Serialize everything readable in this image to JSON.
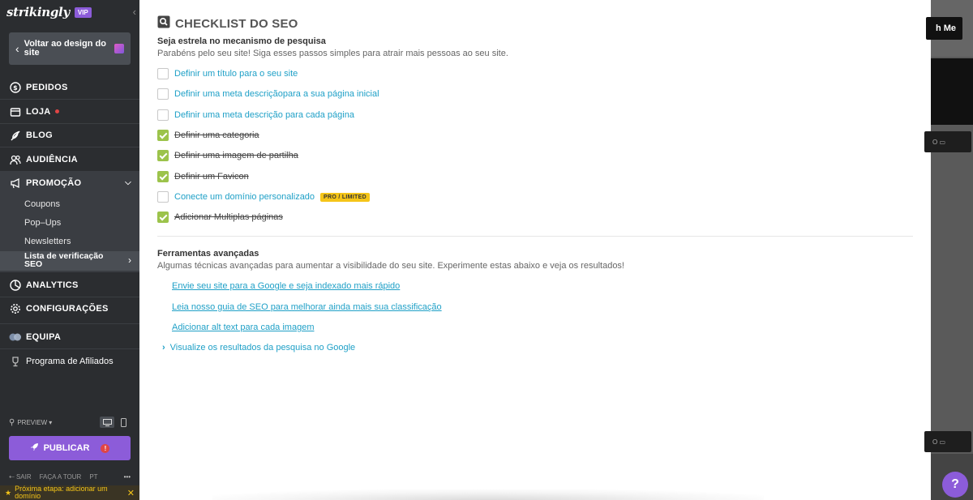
{
  "sidebar": {
    "logo": "strikingly",
    "vip": "VIP",
    "back_label": "Voltar ao design do site",
    "nav": {
      "pedidos": "PEDIDOS",
      "loja": "LOJA",
      "blog": "BLOG",
      "audiencia": "AUDIÊNCIA",
      "promocao": "PROMOÇÃO",
      "analytics": "ANALYTICS",
      "configuracoes": "CONFIGURAÇÕES",
      "equipa": "EQUIPA",
      "afiliados": "Programa de Afiliados"
    },
    "sub": {
      "coupons": "Coupons",
      "popups": "Pop–Ups",
      "newsletters": "Newsletters",
      "seo": "Lista de verificação SEO"
    },
    "preview": "PREVIEW",
    "publish": "PUBLICAR",
    "bottom": {
      "sair": "SAIR",
      "tour": "FAÇA A TOUR",
      "lang": "PT",
      "more": "•••"
    },
    "next_step": "Próxima etapa: adicionar um domínio"
  },
  "seo": {
    "title": "CHECKLIST DO SEO",
    "heading": "Seja estrela no mecanismo de pesquisa",
    "description": "Parabéns pelo seu site! Siga esses passos simples para atrair mais pessoas ao seu site.",
    "items": [
      {
        "label": "Definir um título para o seu site",
        "done": false
      },
      {
        "label": "Definir uma meta descriçãopara a sua página inicial",
        "done": false
      },
      {
        "label": "Definir uma meta descrição para cada página",
        "done": false
      },
      {
        "label": "Definir uma categoria",
        "done": true
      },
      {
        "label": "Definir uma imagem de partilha",
        "done": true
      },
      {
        "label": "Definir um Favicon",
        "done": true
      },
      {
        "label": "Conecte um domínio personalizado",
        "done": false,
        "badge": "PRO / LIMITED"
      },
      {
        "label": "Adicionar Multiplas páginas",
        "done": true
      }
    ],
    "advanced_heading": "Ferramentas avançadas",
    "advanced_description": "Algumas técnicas avançadas para aumentar a visibilidade do seu site. Experimente estas abaixo e veja os resultados!",
    "tools": [
      "Envie seu site para a Google e seja indexado mais rápido",
      "Leia nosso guia de SEO para melhorar ainda mais sua classificação",
      "Adicionar alt text para cada imagem"
    ],
    "google_preview": "Visualize os resultados da pesquisa no Google"
  },
  "background": {
    "button": "h Me",
    "tag1": "O",
    "tag2": "O"
  },
  "help": "?",
  "colors": {
    "accent": "#8c5cd9",
    "link": "#1fa0c7",
    "check": "#9cc34b",
    "badge": "#f5c518"
  }
}
